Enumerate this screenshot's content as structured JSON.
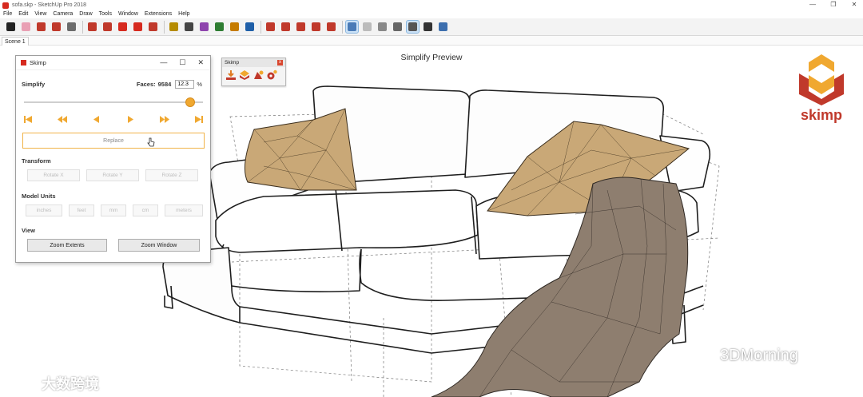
{
  "window": {
    "title": "sofa.skp - SketchUp Pro 2018",
    "controls": [
      "—",
      "❐",
      "✕"
    ]
  },
  "menu": [
    "File",
    "Edit",
    "View",
    "Camera",
    "Draw",
    "Tools",
    "Window",
    "Extensions",
    "Help"
  ],
  "toolbar": {
    "tools": [
      {
        "name": "select-tool-icon",
        "color": "#222222"
      },
      {
        "name": "eraser-tool-icon",
        "color": "#e9a0b4"
      },
      {
        "name": "line-tool-icon",
        "color": "#c0392b"
      },
      {
        "name": "arc-tool-icon",
        "color": "#c0392b"
      },
      {
        "name": "shape-tool-icon",
        "color": "#6b6b6b"
      },
      {
        "name": "push-pull-icon",
        "color": "#c0392b"
      },
      {
        "name": "follow-me-icon",
        "color": "#c0392b"
      },
      {
        "name": "move-tool-icon",
        "color": "#d62a1f"
      },
      {
        "name": "rotate-tool-icon",
        "color": "#d62a1f"
      },
      {
        "name": "scale-tool-icon",
        "color": "#c0392b"
      },
      {
        "name": "tape-measure-icon",
        "color": "#b58b00"
      },
      {
        "name": "text-tool-icon",
        "color": "#444444"
      },
      {
        "name": "paint-bucket-icon",
        "color": "#8e44ad"
      },
      {
        "name": "orbit-tool-icon",
        "color": "#2e7d32"
      },
      {
        "name": "pan-tool-icon",
        "color": "#c57b00"
      },
      {
        "name": "zoom-tool-icon",
        "color": "#1f5fa8"
      },
      {
        "name": "zoom-extents-icon",
        "color": "#c0392b"
      },
      {
        "name": "warehouse-icon",
        "color": "#c0392b"
      },
      {
        "name": "extension-warehouse-icon",
        "color": "#c0392b"
      },
      {
        "name": "share-model-icon",
        "color": "#c0392b"
      },
      {
        "name": "ruby-icon",
        "color": "#c0392b"
      },
      {
        "name": "xray-style-icon",
        "color": "#4a7bb7"
      },
      {
        "name": "wireframe-style-icon",
        "color": "#bbbbbb"
      },
      {
        "name": "hidden-line-style-icon",
        "color": "#888888"
      },
      {
        "name": "shaded-style-icon",
        "color": "#666666"
      },
      {
        "name": "shaded-textures-style-icon",
        "color": "#555555"
      },
      {
        "name": "monochrome-style-icon",
        "color": "#333333"
      },
      {
        "name": "xray-toggle-icon",
        "color": "#3d6fae"
      }
    ]
  },
  "scenes": [
    "Scene 1"
  ],
  "viewport": {
    "title": "Simplify Preview"
  },
  "logo": {
    "text": "skimp",
    "color": "#c0392b"
  },
  "mini_toolbar": {
    "title": "Skimp",
    "close": "x"
  },
  "panel": {
    "title": "Skimp",
    "controls": [
      "—",
      "☐",
      "✕"
    ],
    "simplify": {
      "label": "Simplify",
      "faces_label": "Faces:",
      "faces_value": "9584",
      "percent_value": "12.3",
      "percent_symbol": "%",
      "slider_fraction": 0.93
    },
    "replace_label": "Replace",
    "transform": {
      "label": "Transform",
      "buttons": [
        "Rotate X",
        "Rotate Y",
        "Rotate Z"
      ]
    },
    "model_units": {
      "label": "Model Units",
      "buttons": [
        "inches",
        "feet",
        "mm",
        "cm",
        "meters"
      ]
    },
    "view": {
      "label": "View",
      "buttons": [
        "Zoom Extents",
        "Zoom Window"
      ]
    },
    "accent": "#f0a830"
  },
  "watermarks": {
    "left": "大数跨境",
    "right": "3DMorning"
  }
}
